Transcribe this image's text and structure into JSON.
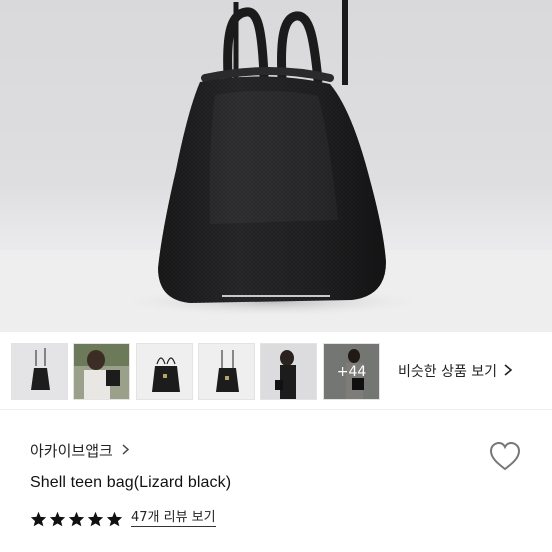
{
  "product": {
    "brand": "아카이브앱크",
    "title": "Shell teen bag(Lizard black)",
    "review_link": "47개 리뷰 보기",
    "rating_stars": 5,
    "favorite": false
  },
  "thumbnails": {
    "more_label": "+44",
    "similar_label": "비슷한 상품 보기",
    "items": [
      "thumbnail-1",
      "thumbnail-2",
      "thumbnail-3",
      "thumbnail-4",
      "thumbnail-5",
      "thumbnail-6"
    ]
  },
  "icons": {
    "brand_chevron": "chevron-right-icon",
    "similar_chevron": "chevron-right-icon",
    "star": "star-icon",
    "heart": "heart-outline-icon"
  },
  "colors": {
    "star": "#111111",
    "bag": "#1c1c1d",
    "background": "#dcdcde"
  }
}
